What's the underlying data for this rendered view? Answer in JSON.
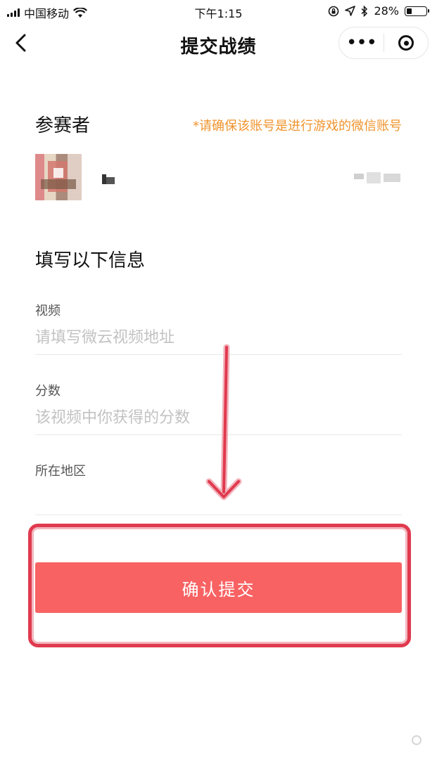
{
  "status_bar": {
    "carrier": "中国移动",
    "time": "下午1:15",
    "battery_percent": "28%",
    "battery_level": 0.28,
    "icons": [
      "signal-icon",
      "wifi-icon",
      "orientation-lock-icon",
      "location-icon",
      "bluetooth-icon",
      "battery-icon"
    ]
  },
  "navbar": {
    "title": "提交战绩",
    "more_label": "•••",
    "icons": [
      "back-arrow-icon",
      "more-icon",
      "close-miniprogram-icon"
    ]
  },
  "participant": {
    "title": "参赛者",
    "note": "*请确保该账号是进行游戏的微信账号"
  },
  "form": {
    "title": "填写以下信息",
    "fields": [
      {
        "label": "视频",
        "placeholder": "请填写微云视频地址",
        "value": ""
      },
      {
        "label": "分数",
        "placeholder": "该视频中你获得的分数",
        "value": ""
      },
      {
        "label": "所在地区",
        "placeholder": "",
        "value": ""
      }
    ]
  },
  "submit": {
    "label": "确认提交"
  },
  "colors": {
    "accent_orange": "#f0942e",
    "submit_red": "#f86263",
    "annotation_red": "#e03a4e"
  }
}
